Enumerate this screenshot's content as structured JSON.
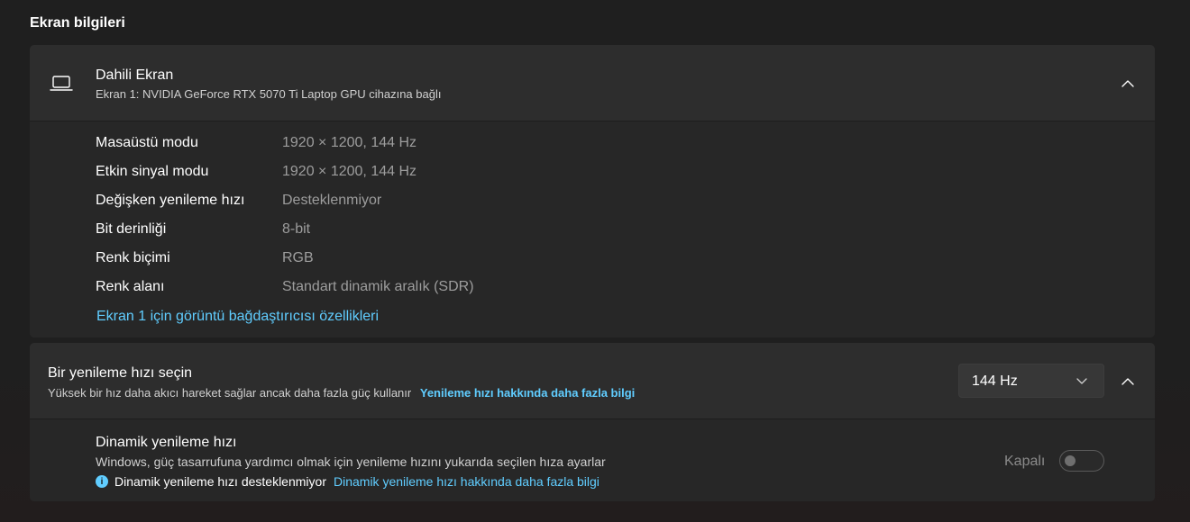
{
  "section_title": "Ekran bilgileri",
  "display_card": {
    "icon": "laptop-icon",
    "title": "Dahili Ekran",
    "subtitle": "Ekran 1: NVIDIA GeForce RTX 5070 Ti Laptop GPU cihazına bağlı",
    "expanded": true,
    "info": [
      {
        "label": "Masaüstü modu",
        "value": "1920 × 1200, 144 Hz"
      },
      {
        "label": "Etkin sinyal modu",
        "value": "1920 × 1200, 144 Hz"
      },
      {
        "label": "Değişken yenileme hızı",
        "value": "Desteklenmiyor"
      },
      {
        "label": "Bit derinliği",
        "value": "8-bit"
      },
      {
        "label": "Renk biçimi",
        "value": "RGB"
      },
      {
        "label": "Renk alanı",
        "value": "Standart dinamik aralık (SDR)"
      }
    ],
    "adapter_link": "Ekran 1 için görüntü bağdaştırıcısı özellikleri"
  },
  "refresh_card": {
    "title": "Bir yenileme hızı seçin",
    "subtitle": "Yüksek bir hız daha akıcı hareket sağlar ancak daha fazla güç kullanır",
    "learn_more": "Yenileme hızı hakkında daha fazla bilgi",
    "selected_rate": "144 Hz",
    "expanded": true,
    "dynamic": {
      "title": "Dinamik yenileme hızı",
      "description": "Windows, güç tasarrufuna yardımcı olmak için yenileme hızını yukarıda seçilen hıza ayarlar",
      "note": "Dinamik yenileme hızı desteklenmiyor",
      "note_link": "Dinamik yenileme hızı hakkında daha fazla bilgi",
      "toggle_label": "Kapalı",
      "toggle_on": false
    }
  },
  "colors": {
    "background": "#202020",
    "card": "#2b2b2b",
    "accent_link": "#60cdff",
    "muted_text": "#9d9d9d"
  }
}
